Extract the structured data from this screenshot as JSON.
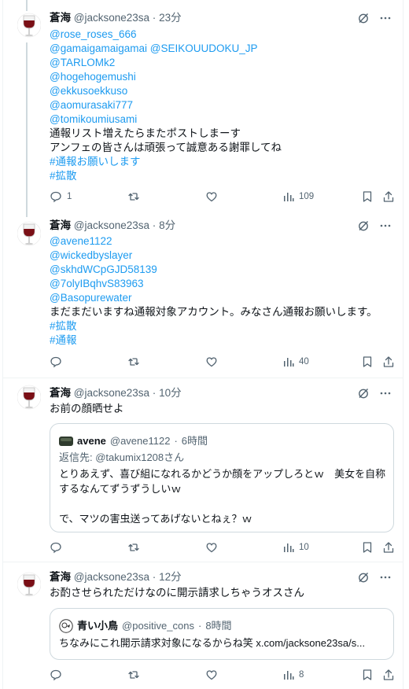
{
  "colors": {
    "accent": "#1d9bf0",
    "text": "#0f1419",
    "muted": "#536471",
    "border": "#cfd9de",
    "divider": "#eff3f4",
    "wine": "#7a0f16"
  },
  "icons": {
    "avatar": "wine-glass-icon",
    "grok": "grok-slash-icon",
    "more": "more-dots-icon",
    "reply": "reply-bubble-icon",
    "retweet": "retweet-icon",
    "like": "heart-icon",
    "views": "views-bars-icon",
    "bookmark": "bookmark-icon",
    "share": "share-icon"
  },
  "tweets": [
    {
      "author": {
        "name": "蒼海",
        "handle": "@jacksone23sa",
        "sep": "·",
        "time": "23分"
      },
      "lines": [
        "@rose_roses_666",
        "@gamaigamaigamai @SEIKOUUDOKU_JP",
        "@TARLOMk2",
        "@hogehogemushi",
        "@ekkusoekkuso",
        "@aomurasaki777",
        "@tomikoumiusami",
        "通報リスト増えたらまたポストしまーす",
        "アンフェの皆さんは頑張って誠意ある謝罪してね",
        "#通報お願いします",
        "#拡散"
      ],
      "stats": {
        "replies": "1",
        "retweets": "",
        "likes": "",
        "views": "109"
      }
    },
    {
      "author": {
        "name": "蒼海",
        "handle": "@jacksone23sa",
        "sep": "·",
        "time": "8分"
      },
      "lines": [
        "@avene1122",
        "@wickedbyslayer",
        "@skhdWCpGJD58139",
        "@7olyIBqhvS83963",
        "@Basopurewater",
        "まだまだいますね通報対象アカウント。みなさん通報お願いします。",
        "#拡散",
        "#通報"
      ],
      "stats": {
        "replies": "",
        "retweets": "",
        "likes": "",
        "views": "40"
      }
    },
    {
      "author": {
        "name": "蒼海",
        "handle": "@jacksone23sa",
        "sep": "·",
        "time": "10分"
      },
      "lines": [
        "お前の顔晒せよ"
      ],
      "quote": {
        "name": "avene",
        "handle": "@avene1122",
        "sep": "·",
        "time": "6時間",
        "reply_to": "返信先: @takumix1208さん",
        "lines": [
          "とりあえず、喜び組になれるかどうか顔をアップしろとｗ　美女を自称",
          "するなんてずうずうしいｗ",
          "",
          "で、マツの害虫送ってあげないとねぇ？ｗ"
        ]
      },
      "stats": {
        "replies": "",
        "retweets": "",
        "likes": "",
        "views": "10"
      }
    },
    {
      "author": {
        "name": "蒼海",
        "handle": "@jacksone23sa",
        "sep": "·",
        "time": "12分"
      },
      "lines": [
        "お酌させられただけなのに開示請求しちゃうオスさん"
      ],
      "quote": {
        "name": "青い小鳥",
        "handle": "@positive_cons",
        "sep": "·",
        "time": "8時間",
        "lines": [
          "ちなみにこれ開示請求対象になるからね笑 x.com/jacksone23sa/s..."
        ]
      },
      "stats": {
        "replies": "",
        "retweets": "",
        "likes": "",
        "views": "8"
      }
    }
  ]
}
